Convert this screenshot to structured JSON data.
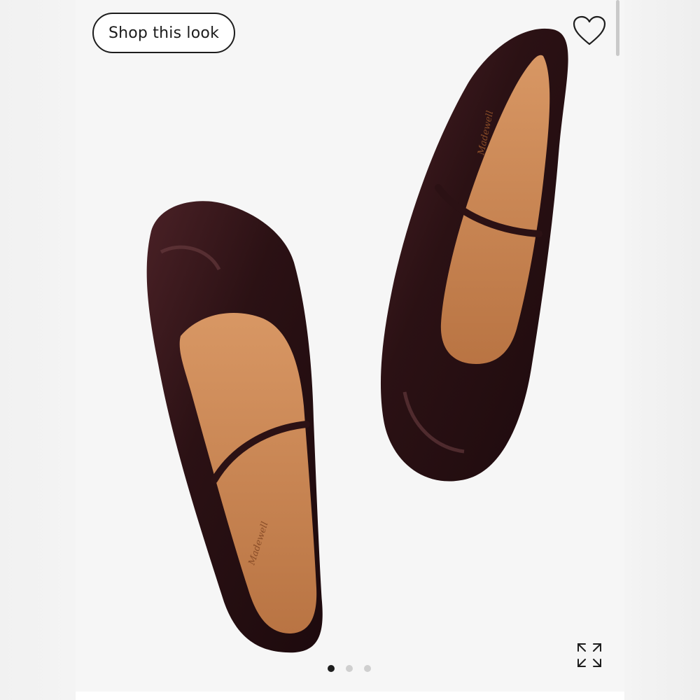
{
  "gallery": {
    "shop_label": "Shop this look",
    "heart_icon": "heart-outline-icon",
    "expand_icon": "expand-icon",
    "dots_total": 3,
    "active_dot": 1
  },
  "product": {
    "left_insole_logo": "Madewell",
    "right_insole_logo": "Madewell"
  },
  "colors": {
    "patent_leather": "#2b1114",
    "insole": "#c9824e",
    "background": "#f6f6f6"
  }
}
